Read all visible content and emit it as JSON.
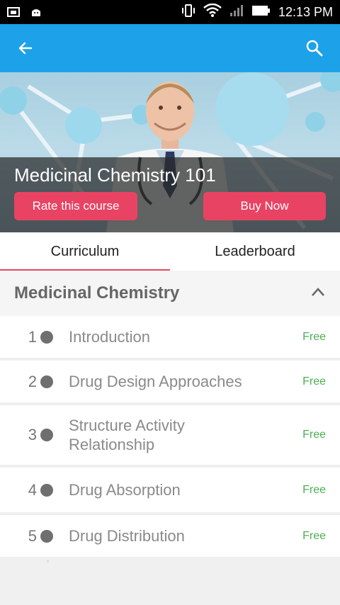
{
  "status_bar": {
    "time": "12:13 PM"
  },
  "app_bar": {},
  "hero": {
    "title": "Medicinal Chemistry 101",
    "rate_label": "Rate this course",
    "buy_label": "Buy Now"
  },
  "tabs": [
    {
      "label": "Curriculum",
      "active": true
    },
    {
      "label": "Leaderboard",
      "active": false
    }
  ],
  "section": {
    "title": "Medicinal Chemistry"
  },
  "lessons": [
    {
      "num": "1",
      "title": "Introduction",
      "price": "Free"
    },
    {
      "num": "2",
      "title": "Drug Design Approaches",
      "price": "Free"
    },
    {
      "num": "3",
      "title": "Structure Activity Relationship",
      "price": "Free"
    },
    {
      "num": "4",
      "title": "Drug Absorption",
      "price": "Free"
    },
    {
      "num": "5",
      "title": "Drug Distribution",
      "price": "Free"
    }
  ],
  "colors": {
    "app_bar": "#1da1e8",
    "accent": "#e94363",
    "free": "#4caf50"
  }
}
